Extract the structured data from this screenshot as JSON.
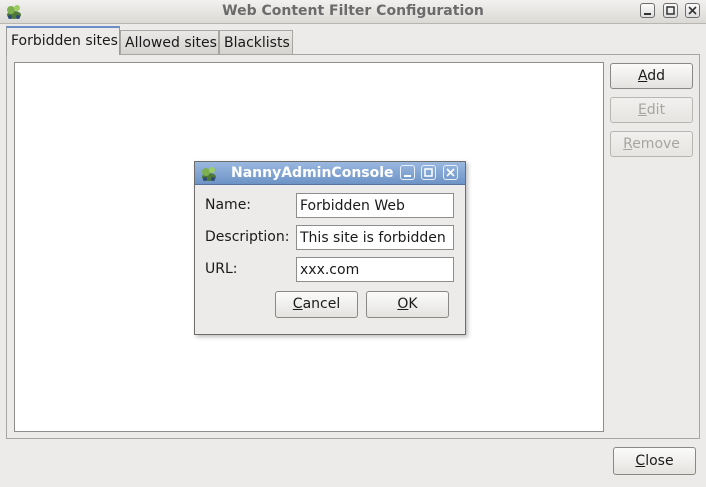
{
  "window": {
    "title": "Web Content Filter Configuration",
    "controls": [
      "minimize",
      "maximize",
      "close"
    ]
  },
  "tabs": [
    {
      "label": "Forbidden sites",
      "active": true
    },
    {
      "label": "Allowed sites",
      "active": false
    },
    {
      "label": "Blacklists",
      "active": false
    }
  ],
  "side_buttons": {
    "add": {
      "first": "A",
      "rest": "dd",
      "enabled": true
    },
    "edit": {
      "first": "E",
      "rest": "dit",
      "enabled": false
    },
    "remove": {
      "first": "R",
      "rest": "emove",
      "enabled": false
    }
  },
  "close_button": {
    "first": "C",
    "rest": "lose"
  },
  "dialog": {
    "title": "NannyAdminConsole",
    "fields": {
      "name": {
        "label": "Name:",
        "value": "Forbidden Web"
      },
      "description": {
        "label": "Description:",
        "value": "This site is forbidden"
      },
      "url": {
        "label": "URL:",
        "value": "xxx.com"
      }
    },
    "cancel": {
      "first": "C",
      "rest": "ancel"
    },
    "ok": {
      "first": "O",
      "rest": "K"
    }
  },
  "colors": {
    "dialog_titlebar": "#6d93c6",
    "active_tab_accent": "#6a8fc4"
  }
}
